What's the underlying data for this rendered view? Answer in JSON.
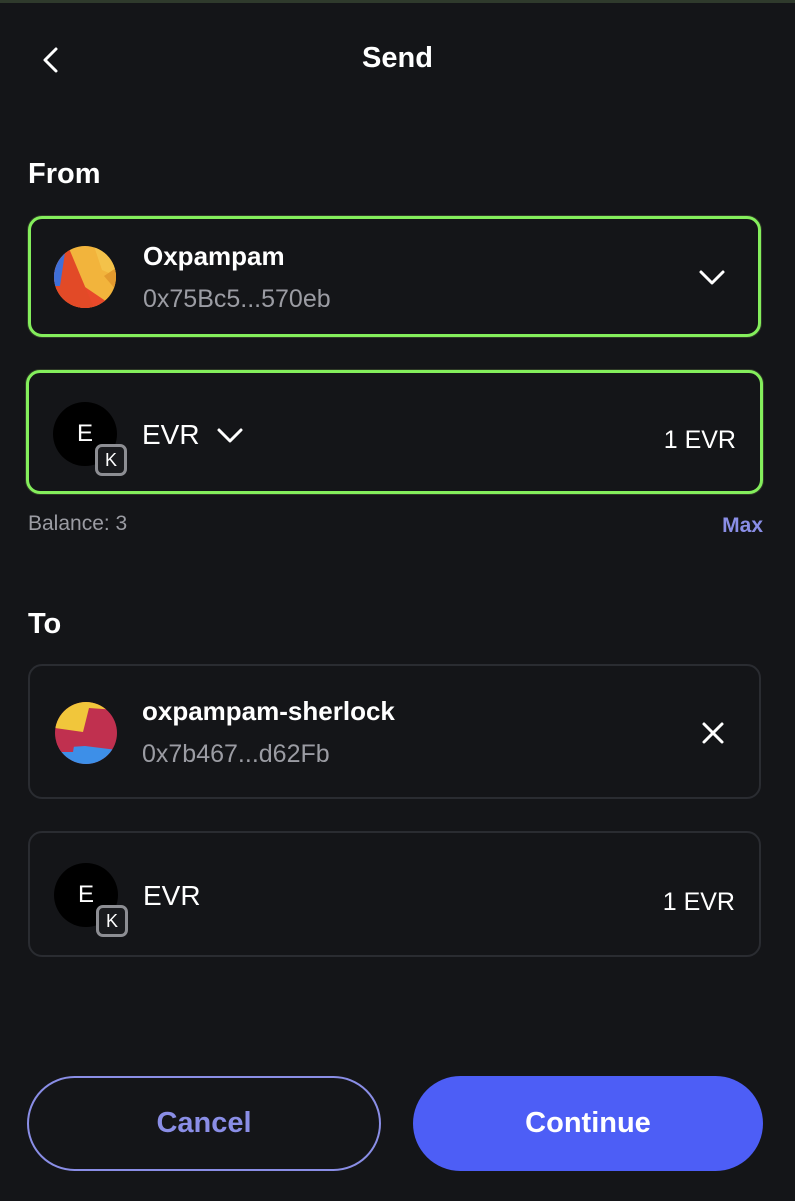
{
  "header": {
    "title": "Send"
  },
  "from": {
    "label": "From",
    "account": {
      "name": "Oxpampam",
      "address": "0x75Bc5...570eb"
    },
    "token": {
      "icon_letter": "E",
      "chain_badge": "K",
      "symbol": "EVR",
      "amount": "1 EVR"
    },
    "balance": "Balance: 3",
    "max_label": "Max"
  },
  "to": {
    "label": "To",
    "recipient": {
      "name": "oxpampam-sherlock",
      "address": "0x7b467...d62Fb"
    },
    "token": {
      "icon_letter": "E",
      "chain_badge": "K",
      "symbol": "EVR",
      "amount": "1 EVR"
    }
  },
  "actions": {
    "cancel_label": "Cancel",
    "continue_label": "Continue"
  },
  "colors": {
    "accent_green": "#84ee5c",
    "primary_blue": "#4d5ef6",
    "link_purple": "#8a8ee6",
    "background": "#141518"
  },
  "icons": {
    "back": "chevron-left-icon",
    "dropdown": "chevron-down-icon",
    "clear": "close-icon"
  }
}
